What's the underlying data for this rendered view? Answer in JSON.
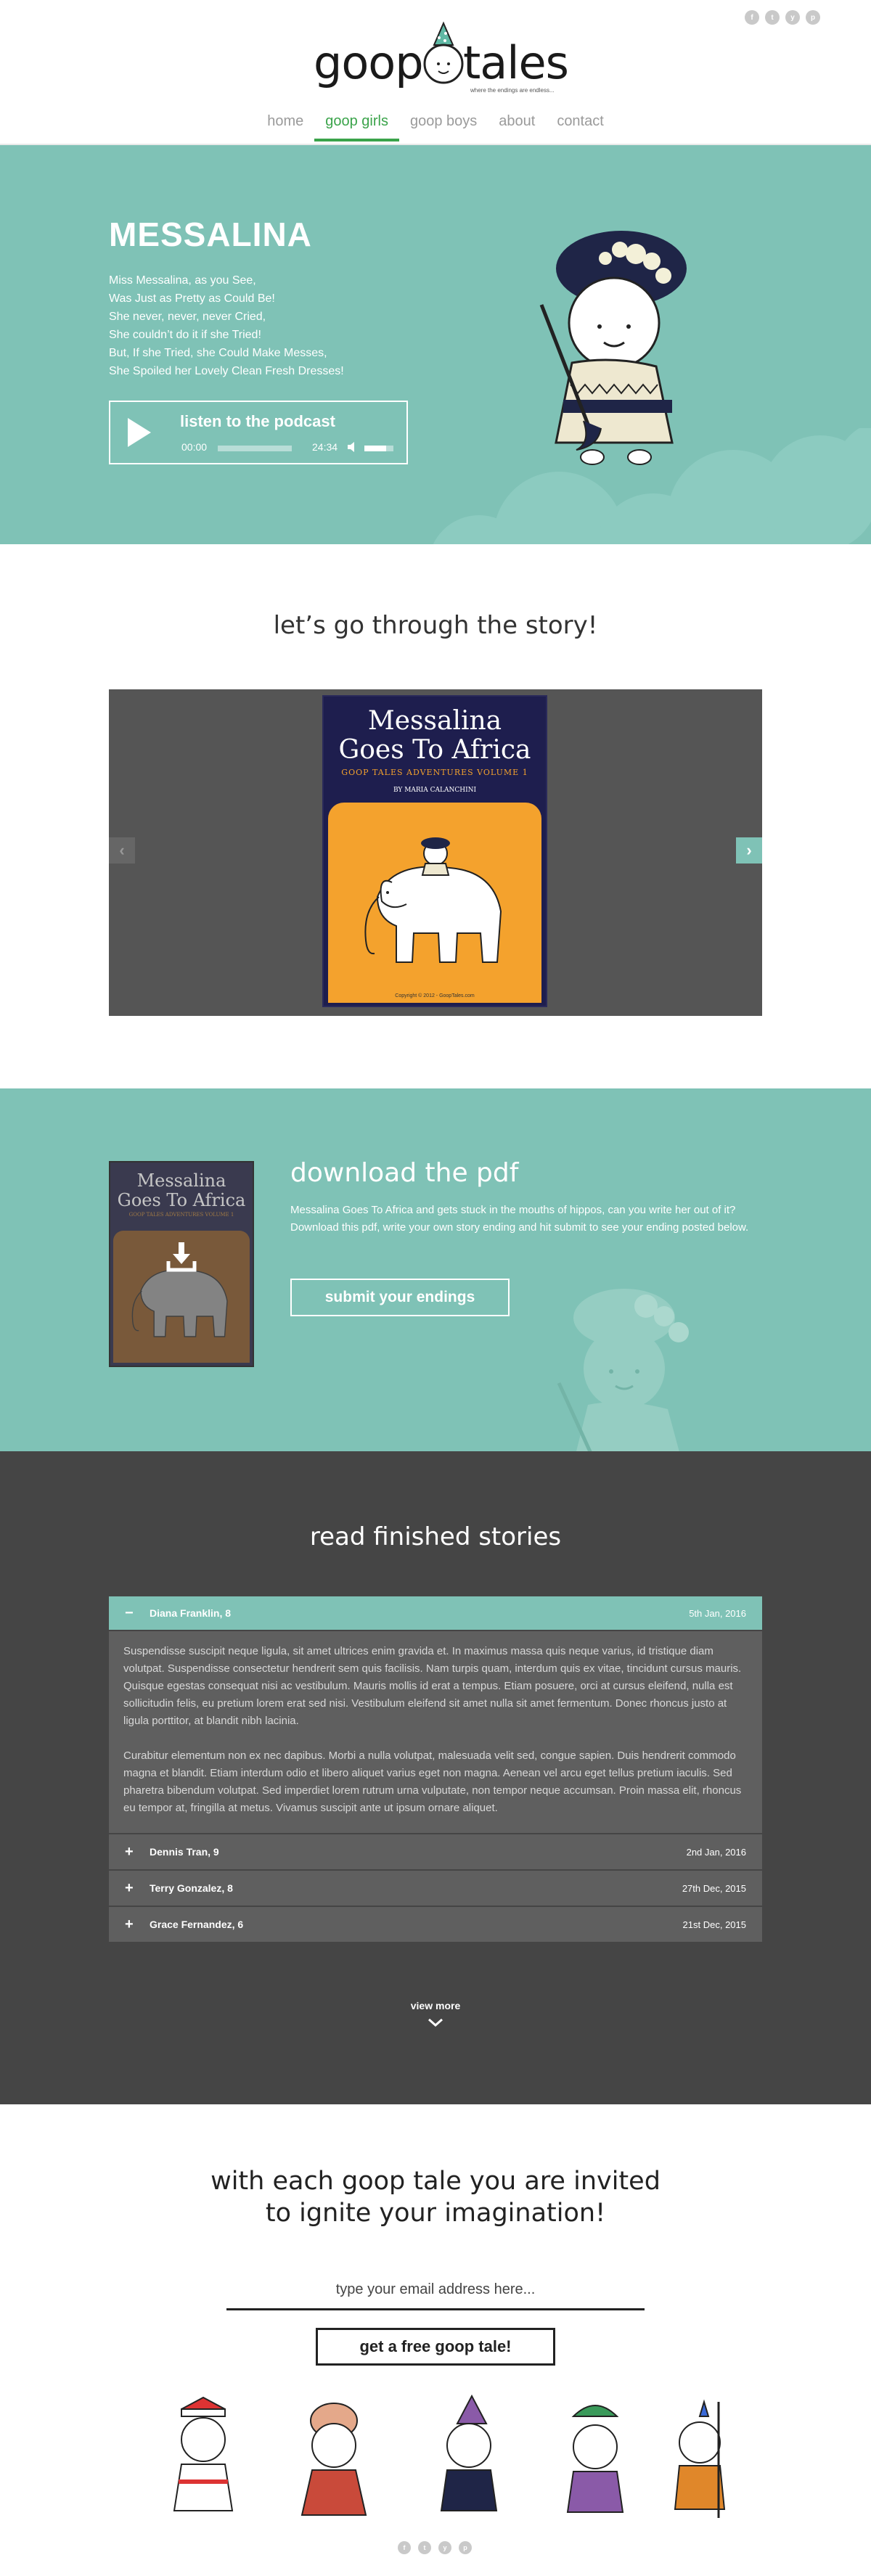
{
  "header": {
    "logo_word_a": "goop",
    "logo_word_b": "tales",
    "logo_tagline": "where the endings are endless...",
    "social": [
      "f",
      "t",
      "y",
      "p"
    ]
  },
  "nav": {
    "items": [
      {
        "label": "home",
        "active": false
      },
      {
        "label": "goop girls",
        "active": true
      },
      {
        "label": "goop boys",
        "active": false
      },
      {
        "label": "about",
        "active": false
      },
      {
        "label": "contact",
        "active": false
      }
    ],
    "accent_color": "#3aa34a"
  },
  "hero": {
    "title": "MESSALINA",
    "poem": [
      "Miss Messalina, as you See,",
      "Was Just as Pretty as Could Be!",
      "She never, never, never Cried,",
      "She couldn’t do it if she Tried!",
      "But, If she Tried, she Could Make Messes,",
      "She Spoiled her Lovely Clean Fresh Dresses!"
    ],
    "background_color": "#7fc2b6",
    "player": {
      "title": "listen to the podcast",
      "current_time": "00:00",
      "duration": "24:34",
      "progress": 0,
      "volume": 0.75
    }
  },
  "story": {
    "heading": "let’s go through the story!",
    "book": {
      "title_line1": "Messalina",
      "title_line2": "Goes To Africa",
      "subtitle": "GOOP TALES ADVENTURES VOLUME 1",
      "author": "BY MARIA CALANCHINI",
      "copyright": "Copyright © 2012 - GoopTales.com"
    },
    "prev_icon": "chevron-left-icon",
    "next_icon": "chevron-right-icon"
  },
  "download": {
    "heading": "download the pdf",
    "text": "Messalina Goes To Africa and gets stuck in the mouths of hippos, can you write her out of it? Download this pdf, write your own story ending and hit submit to see your ending posted below.",
    "button": "submit your endings",
    "book_title_line1": "Messalina",
    "book_title_line2": "Goes To Africa",
    "book_subtitle": "GOOP TALES ADVENTURES VOLUME 1"
  },
  "stories": {
    "heading": "read finished stories",
    "items": [
      {
        "sign": "−",
        "name": "Diana Franklin, 8",
        "date": "5th Jan, 2016",
        "open": true,
        "paragraphs": [
          "Suspendisse suscipit neque ligula, sit amet ultrices enim gravida et. In maximus massa quis neque varius, id tristique diam volutpat. Suspendisse consectetur hendrerit sem quis facilisis. Nam turpis quam, interdum quis ex vitae, tincidunt cursus mauris. Quisque egestas consequat nisi ac vestibulum. Mauris mollis id erat a tempus. Etiam posuere, orci at cursus eleifend, nulla est sollicitudin felis, eu pretium lorem erat sed nisi. Vestibulum eleifend sit amet nulla sit amet fermentum. Donec rhoncus justo at ligula porttitor, at blandit nibh lacinia.",
          "Curabitur elementum non ex nec dapibus. Morbi a nulla volutpat, malesuada velit sed, congue sapien. Duis hendrerit commodo magna et blandit. Etiam interdum odio et libero aliquet varius eget non magna. Aenean vel arcu eget tellus pretium iaculis. Sed pharetra bibendum volutpat. Sed imperdiet lorem rutrum urna vulputate, non tempor neque accumsan. Proin massa elit, rhoncus eu tempor at, fringilla at metus. Vivamus suscipit ante ut ipsum ornare aliquet."
        ]
      },
      {
        "sign": "+",
        "name": "Dennis Tran, 9",
        "date": "2nd Jan, 2016",
        "open": false
      },
      {
        "sign": "+",
        "name": "Terry Gonzalez, 8",
        "date": "27th Dec, 2015",
        "open": false
      },
      {
        "sign": "+",
        "name": "Grace Fernandez, 6",
        "date": "21st Dec, 2015",
        "open": false
      }
    ],
    "view_more": "view more"
  },
  "cta": {
    "line1": "with each goop tale you are invited",
    "line2": "to ignite your imagination!",
    "email_placeholder": "type your email address here...",
    "button": "get a free goop tale!"
  },
  "footer": {
    "social": [
      "f",
      "t",
      "y",
      "p"
    ]
  }
}
